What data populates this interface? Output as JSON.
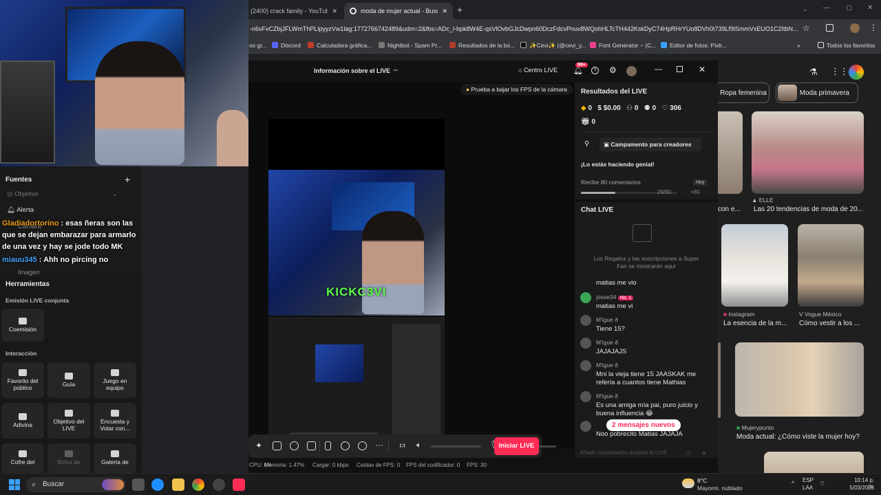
{
  "browser": {
    "tabs": [
      "(2400) crack family - YouTube",
      "moda de mujer actual - Buscar"
    ],
    "url": "-n6vFvCZbjJFLWmThPLlpyyzVw1lag:1772766742489&udm=2&fbs=ADc_l-bpk8W4E-qsVlOvbGJcDwpn60DczFdcvPnuv8WQohHLTcTH442KskDyC74HpRHrYUo8DVh0t739Lf9lSmmVxEUO1C2ItbN...",
    "bookmarks": [
      "Discord",
      "Calculadora gráfica...",
      "Nightbot - Spam Pr...",
      "Resultados de la bú...",
      "✨Cevi✨ (@cevi_y...",
      "Font Generator ~ (C...",
      "Editor de fotos: Pixlr...",
      "Todos los favoritos"
    ],
    "bookmark_partial": "os gr..."
  },
  "google": {
    "chips": [
      "Ropa femenina",
      "Moda primavera"
    ],
    "results": [
      {
        "source": "ELLE",
        "caption": "Las 20 tendencias de moda de 20..."
      },
      {
        "source": "",
        "caption": "con e..."
      },
      {
        "source": "Instagram",
        "caption": "La esencia de la m..."
      },
      {
        "source": "Vogue México",
        "caption": "Cómo vestir a los ..."
      },
      {
        "source": "Mujerypunto",
        "caption": "Moda actual: ¿Cómo viste la mujer hoy?"
      }
    ]
  },
  "stream_overlay": {
    "chat": [
      {
        "user": "Gladiadortorino",
        "text": " : esas ñeras son las que se dejan embarazar para armarlo de una vez y hay se jode todo MK"
      },
      {
        "user": "miauu345",
        "text": " : Ahh no pircing no"
      }
    ],
    "camera_brand": "KICKC3VI"
  },
  "sources_panel": {
    "title": "Fuentes",
    "items": [
      "Objetivo",
      "Alerta",
      "Cámara",
      "Imagen"
    ],
    "tools_title": "Herramientas",
    "sections": [
      {
        "title": "Emisión LIVE conjunta",
        "tools": [
          "Coemisión"
        ]
      },
      {
        "title": "Interacción",
        "tools": [
          "Favorito del público",
          "Guía",
          "Juego en equipo",
          "Adivina",
          "Objetivo del LIVE",
          "Encuesta y Votar con...",
          "Cofre del",
          "Bolsa de",
          "Galería de"
        ]
      }
    ]
  },
  "tiktok": {
    "header_title": "Información sobre el LIVE",
    "centro_live": "Centro LIVE",
    "notif_badge": "99+",
    "fps_tip": "Prueba a bajar los FPS de la cámara",
    "results_title": "Resultados del LIVE",
    "stats": [
      "0",
      "$0.00",
      "0",
      "0",
      "306",
      "0"
    ],
    "campamento": "Campamento para creadores",
    "praise": "¡Lo estás haciendo genial!",
    "task": "Recibe 80 comentarios",
    "task_when": "Hoy",
    "task_progress": "29/80",
    "task_progress_fraction": 0.36,
    "task_reward": "×80",
    "chat_title": "Chat LIVE",
    "gifts_note": "Los Regalos y las suscripciones a Super Fan se mostrarán aquí",
    "chat": [
      {
        "name": "",
        "msg": "matias me vio"
      },
      {
        "name": "josse34",
        "badge": "No. 1",
        "msg": "matias me vi"
      },
      {
        "name": "M'igue ð",
        "msg": "Tiene 15?"
      },
      {
        "name": "M'igue ð",
        "msg": "JAJAJAJS"
      },
      {
        "name": "M'igue ð",
        "msg": "Mni la vieja tiene 15 JAASKAK me refería a cuantos tiene Mathias"
      },
      {
        "name": "M'igue ð",
        "msg": "Es una amiga mía pai, puro juicio y buena influencia 😂"
      },
      {
        "name": "",
        "msg": "Noo pobrecito Matias JAJAJA"
      }
    ],
    "new_messages": "2 mensajes nuevos",
    "comment_placeholder": "Añadir comentarios durante el LIVE",
    "go_live": "Iniciar LIVE",
    "mic_level": 0.6,
    "status": {
      "cpu": "CPU: 6%",
      "mem": "Memoria: 1.47%",
      "upload": "Cargar: 0 kbps",
      "drops": "Caídas de FPS: 0",
      "encoder": "FPS del codificador: 0",
      "fps": "FPS: 30"
    }
  },
  "taskbar": {
    "search": "Buscar",
    "weather_temp": "8°C",
    "weather_desc": "Mayorm. nublado",
    "lang": "ESP",
    "lang2": "LAA",
    "time": "10:14 p. m.",
    "date": "5/03/2026"
  },
  "colors": {
    "accent_pink": "#fe2c55",
    "green": "#33d17a"
  }
}
